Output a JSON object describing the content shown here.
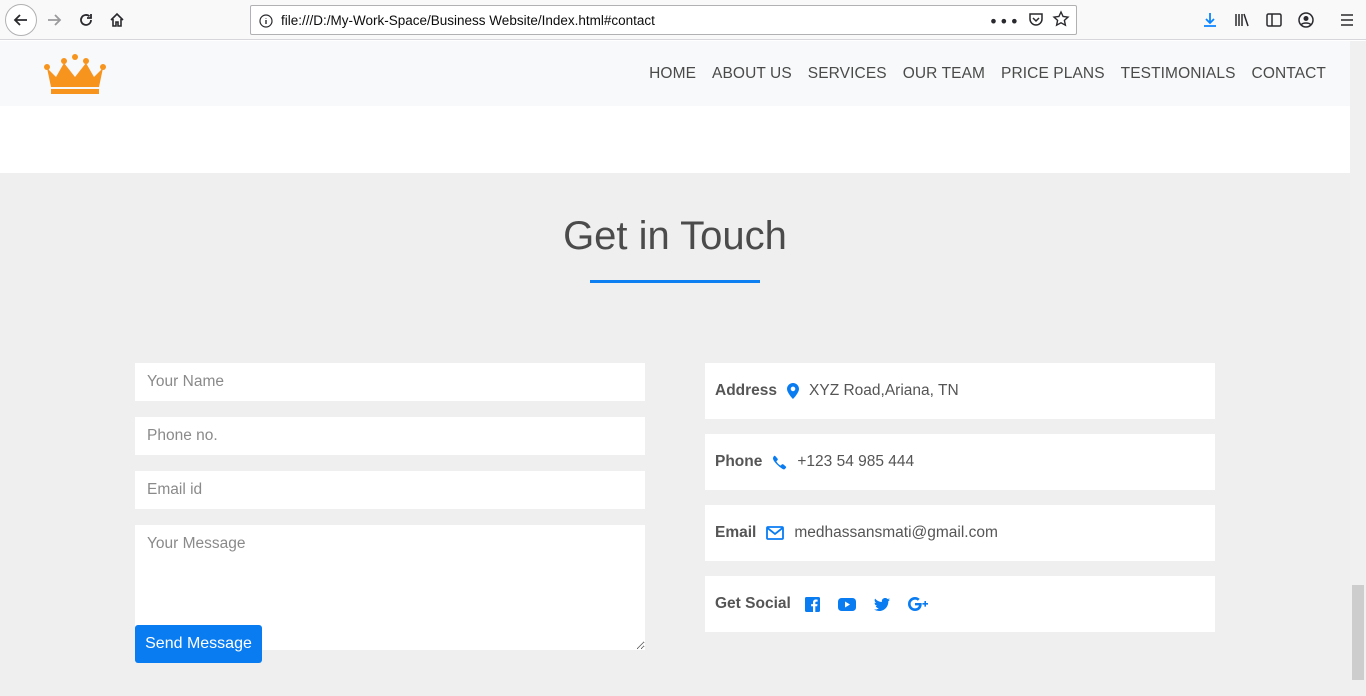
{
  "browser": {
    "url": "file:///D:/My-Work-Space/Business Website/Index.html#contact"
  },
  "nav": {
    "items": [
      "HOME",
      "ABOUT US",
      "SERVICES",
      "OUR TEAM",
      "PRICE PLANS",
      "TESTIMONIALS",
      "CONTACT"
    ]
  },
  "contact": {
    "title": "Get in Touch",
    "form": {
      "name_placeholder": "Your Name",
      "phone_placeholder": "Phone no.",
      "email_placeholder": "Email id",
      "message_placeholder": "Your Message",
      "submit_label": "Send Message"
    },
    "info": {
      "address_label": "Address",
      "address_value": "XYZ Road,Ariana, TN",
      "phone_label": "Phone",
      "phone_value": "+123 54 985 444",
      "email_label": "Email",
      "email_value": "medhassansmati@gmail.com",
      "social_label": "Get Social",
      "social_icons": [
        "facebook-icon",
        "youtube-icon",
        "twitter-icon",
        "google-plus-icon"
      ]
    }
  },
  "colors": {
    "accent": "#0a7cf2",
    "logo": "#f7941d",
    "section_bg": "#efefef",
    "navbar_bg": "#f8f9fa"
  }
}
